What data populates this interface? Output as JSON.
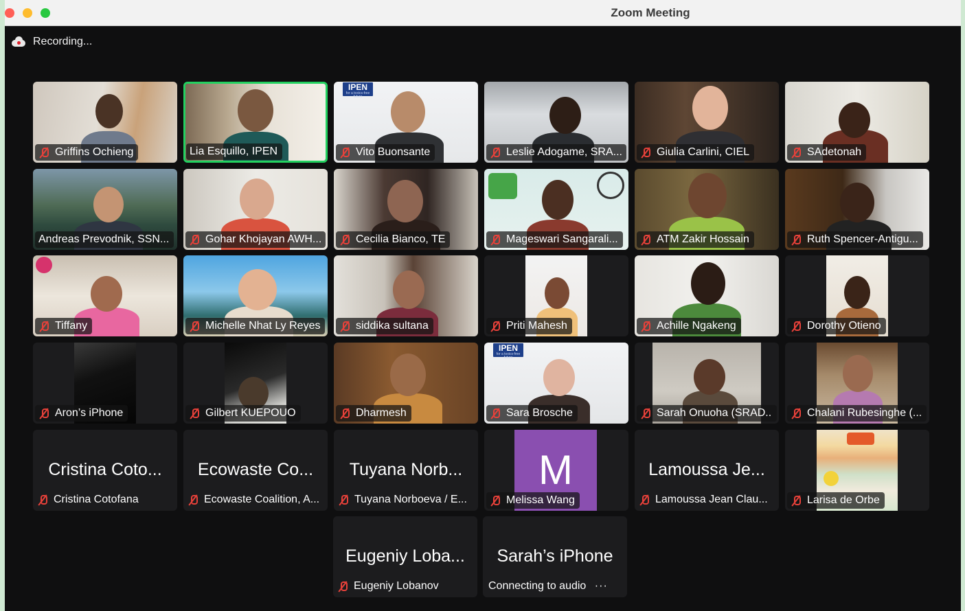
{
  "window": {
    "title": "Zoom Meeting"
  },
  "recording": {
    "label": "Recording..."
  },
  "participants": [
    {
      "name": "Griffins Ochieng",
      "muted": true
    },
    {
      "name": "Lia Esquillo, IPEN",
      "muted": false,
      "active_speaker": true
    },
    {
      "name": "Vito Buonsante",
      "muted": true
    },
    {
      "name": "Leslie Adogame, SRA...",
      "muted": true
    },
    {
      "name": "Giulia Carlini, CIEL",
      "muted": true
    },
    {
      "name": "SAdetonah",
      "muted": true
    },
    {
      "name": "Andreas Prevodnik, SSN...",
      "muted": false
    },
    {
      "name": "Gohar Khojayan AWH...",
      "muted": true
    },
    {
      "name": "Cecilia Bianco, TE",
      "muted": true
    },
    {
      "name": "Mageswari Sangarali...",
      "muted": true
    },
    {
      "name": "ATM Zakir Hossain",
      "muted": true
    },
    {
      "name": "Ruth Spencer-Antigu...",
      "muted": true
    },
    {
      "name": "Tiffany",
      "muted": true
    },
    {
      "name": "Michelle Nhat Ly Reyes",
      "muted": true
    },
    {
      "name": "siddika sultana",
      "muted": true
    },
    {
      "name": "Priti Mahesh",
      "muted": true
    },
    {
      "name": "Achille Ngakeng",
      "muted": true
    },
    {
      "name": "Dorothy Otieno",
      "muted": true
    },
    {
      "name": "Aron’s iPhone",
      "muted": true
    },
    {
      "name": "Gilbert KUEPOUO",
      "muted": true
    },
    {
      "name": "Dharmesh",
      "muted": true
    },
    {
      "name": "Sara Brosche",
      "muted": true
    },
    {
      "name": "Sarah Onuoha (SRAD...",
      "muted": true
    },
    {
      "name": "Chalani Rubesinghe (...",
      "muted": true
    },
    {
      "name": "Cristina Cotofana",
      "display_name": "Cristina Coto...",
      "muted": true,
      "video_off": true
    },
    {
      "name": "Ecowaste Coalition, A...",
      "display_name": "Ecowaste Co...",
      "muted": true,
      "video_off": true
    },
    {
      "name": "Tuyana Norboeva / E...",
      "display_name": "Tuyana Norb...",
      "muted": true,
      "video_off": true
    },
    {
      "name": "Melissa Wang",
      "avatar_letter": "M",
      "muted": true
    },
    {
      "name": "Lamoussa Jean Clau...",
      "display_name": "Lamoussa Je...",
      "muted": true,
      "video_off": true
    },
    {
      "name": "Larisa de Orbe",
      "muted": true
    },
    {
      "name": "Eugeniy Lobanov",
      "display_name": "Eugeniy Loba...",
      "muted": true,
      "video_off": true
    },
    {
      "name": "Connecting to audio",
      "display_name": "Sarah’s iPhone",
      "video_off": true
    }
  ],
  "logos": {
    "ipen": "IPEN",
    "ipen_tagline": "for a toxics-free future"
  },
  "colors": {
    "active_border": "#23d160",
    "mute_icon": "#e8413a",
    "avatar_bg": "#8a4fb0"
  }
}
